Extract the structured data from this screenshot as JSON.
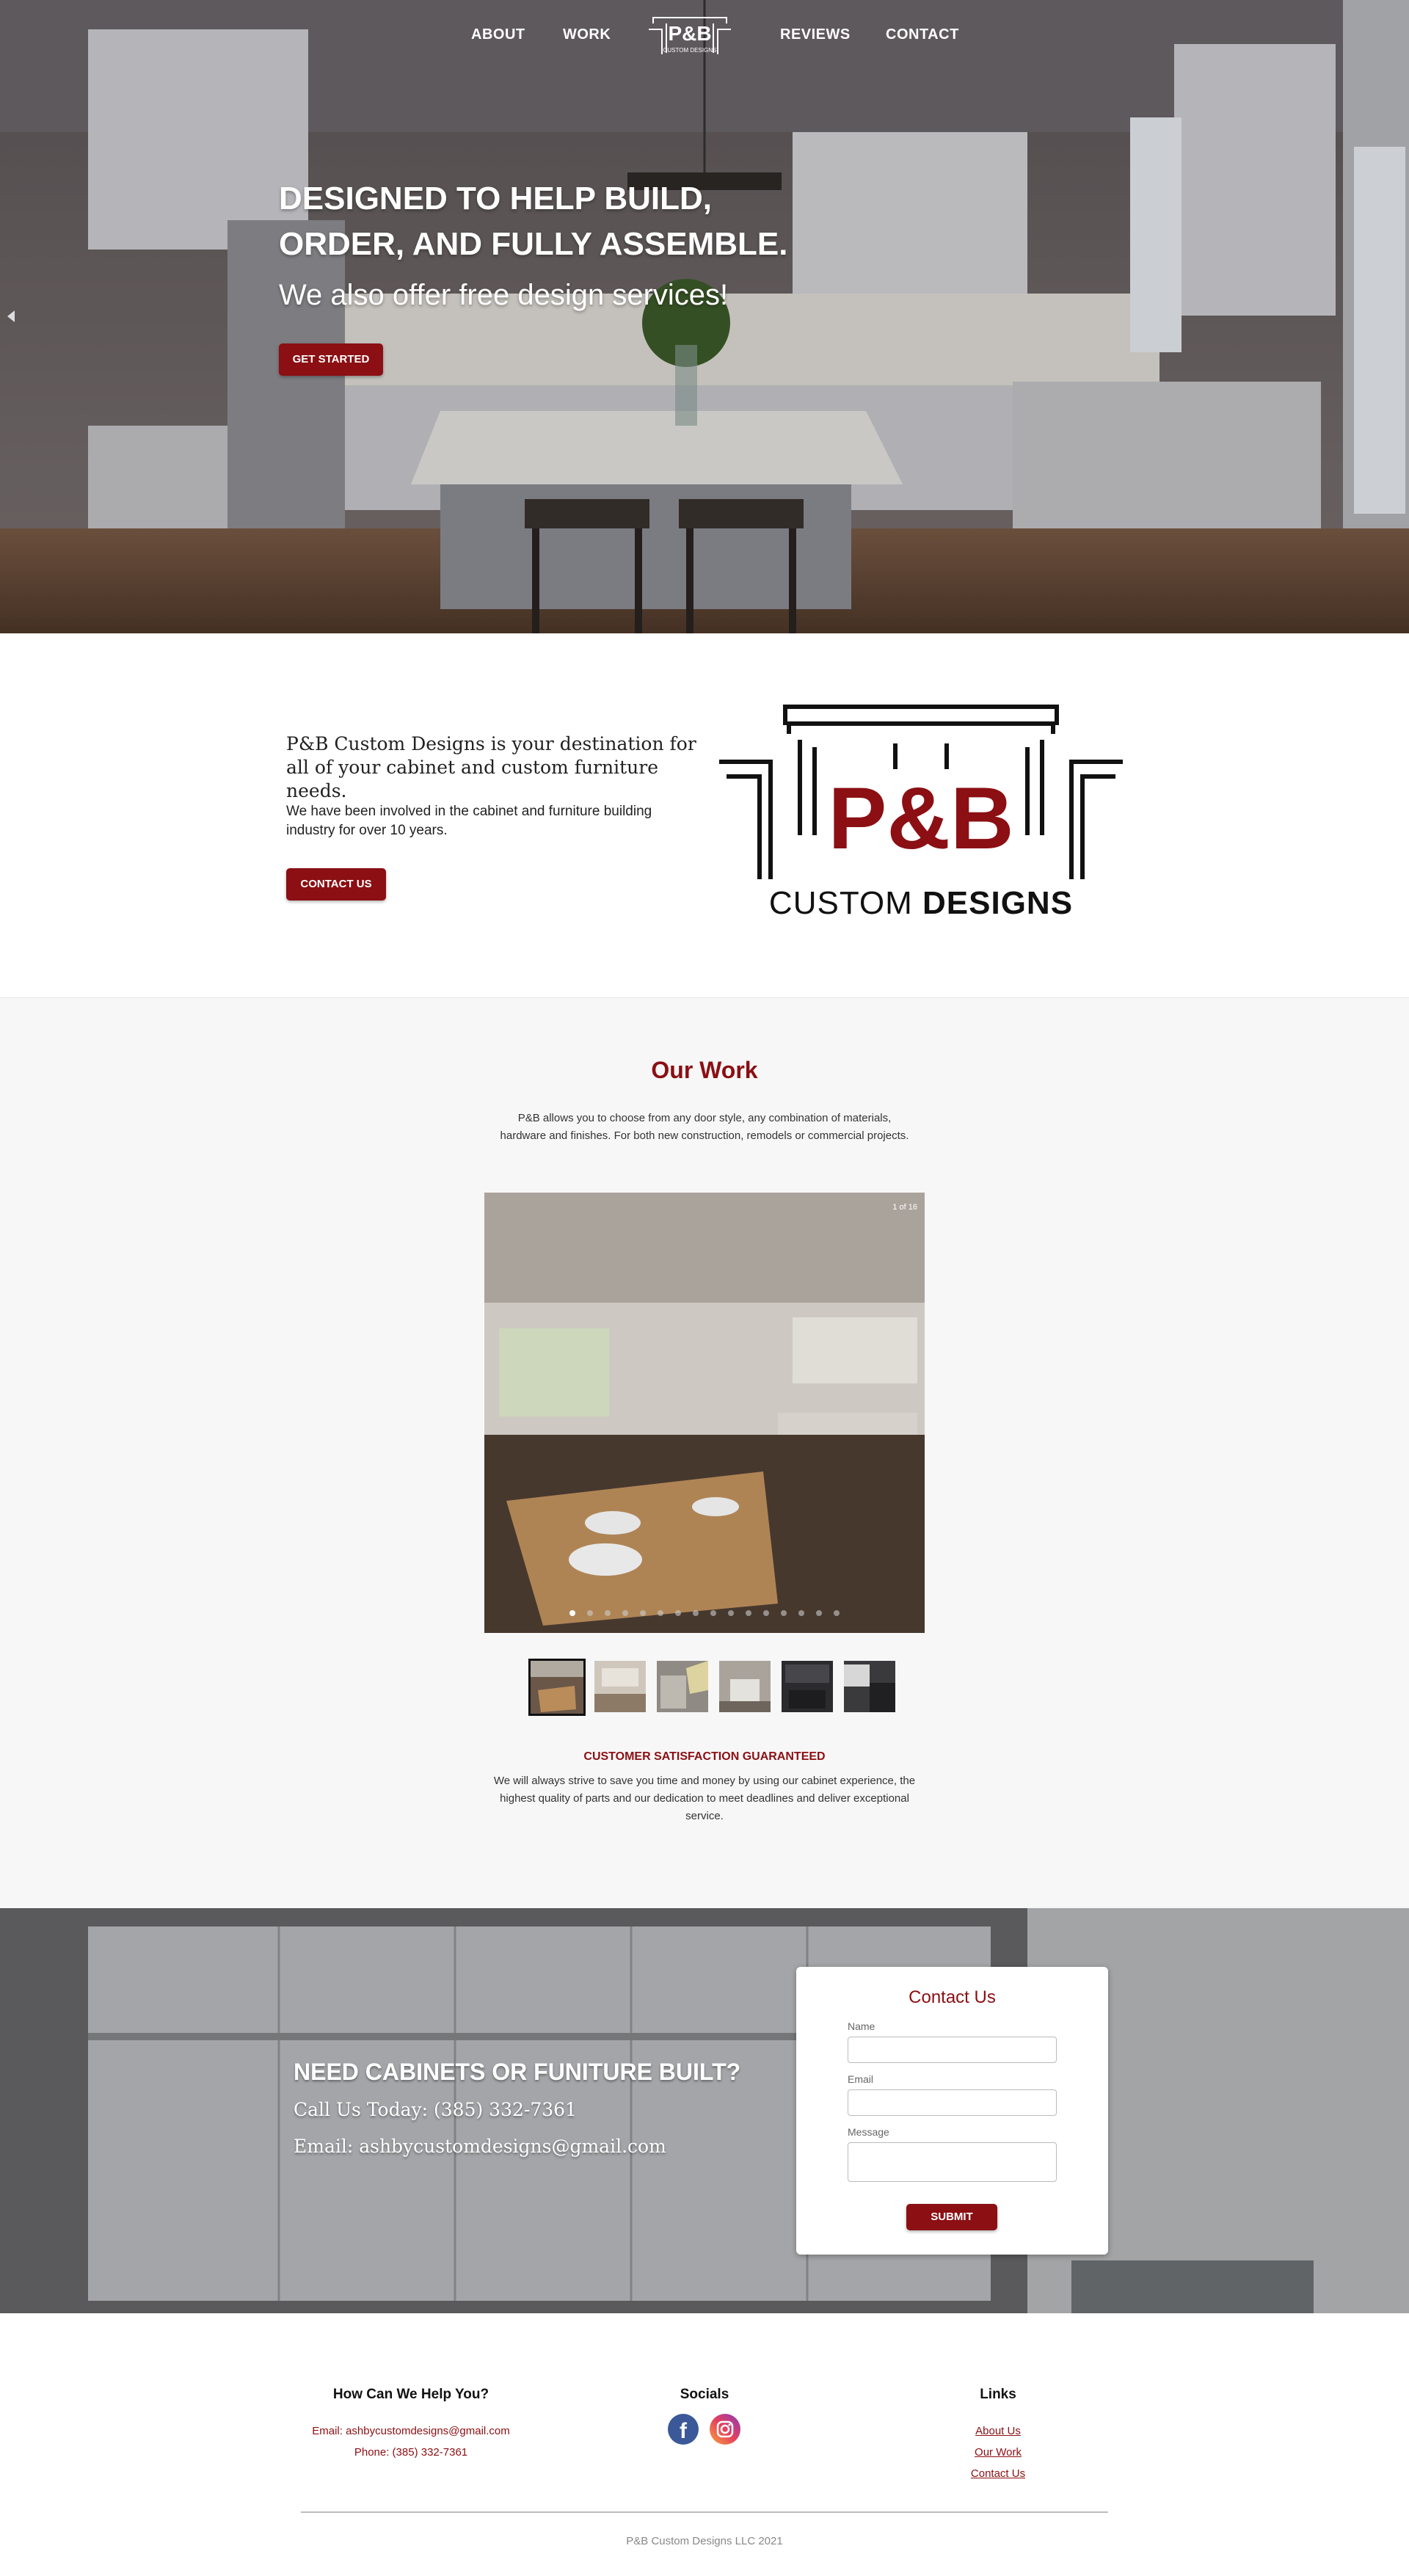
{
  "nav": {
    "items": [
      {
        "label": "ABOUT"
      },
      {
        "label": "WORK"
      },
      {
        "label": "REVIEWS"
      },
      {
        "label": "CONTACT"
      }
    ],
    "logo_text": "P&B",
    "logo_sub": "CUSTOM DESIGNS"
  },
  "hero": {
    "title_line1": "DESIGNED TO HELP BUILD,",
    "title_line2": "ORDER, AND FULLY ASSEMBLE.",
    "subtitle": "We also offer free design services!",
    "cta_label": "GET STARTED"
  },
  "intro": {
    "heading": "P&B Custom Designs is your destination for all of your cabinet and custom furniture needs.",
    "body": "We have been involved in the cabinet and furniture building industry for over 10 years.",
    "cta_label": "CONTACT US",
    "logo_main": "P&B",
    "logo_custom": "CUSTOM",
    "logo_designs": "DESIGNS"
  },
  "work": {
    "title": "Our Work",
    "description": "P&B allows you to choose from any door style, any combination of materials, hardware and finishes. For both new construction, remodels or commercial projects.",
    "counter": "1 of 16",
    "dot_count": 16,
    "active_dot": 0,
    "satisfaction_title": "CUSTOMER SATISFACTION GUARANTEED",
    "satisfaction_body": "We will always strive to save you time and money by using our cabinet experience, the highest quality of parts and our dedication to meet deadlines and deliver exceptional service."
  },
  "contact": {
    "heading": "NEED CABINETS OR FUNITURE BUILT?",
    "phone_line": "Call Us Today: (385) 332-7361",
    "email_line": "Email: ashbycustomdesigns@gmail.com",
    "form": {
      "title": "Contact Us",
      "name_label": "Name",
      "email_label": "Email",
      "message_label": "Message",
      "submit_label": "SUBMIT"
    }
  },
  "footer": {
    "help_title": "How Can We Help You?",
    "help_email": "Email: ashbycustomdesigns@gmail.com",
    "help_phone": "Phone: (385) 332-7361",
    "socials_title": "Socials",
    "social_icons": [
      "facebook-icon",
      "instagram-icon"
    ],
    "links_title": "Links",
    "links": [
      {
        "label": "About Us"
      },
      {
        "label": "Our Work"
      },
      {
        "label": "Contact Us"
      }
    ],
    "copyright": "P&B Custom Designs LLC 2021"
  },
  "colors": {
    "brand_red": "#8b0f13",
    "facebook_blue": "#3b5998"
  }
}
